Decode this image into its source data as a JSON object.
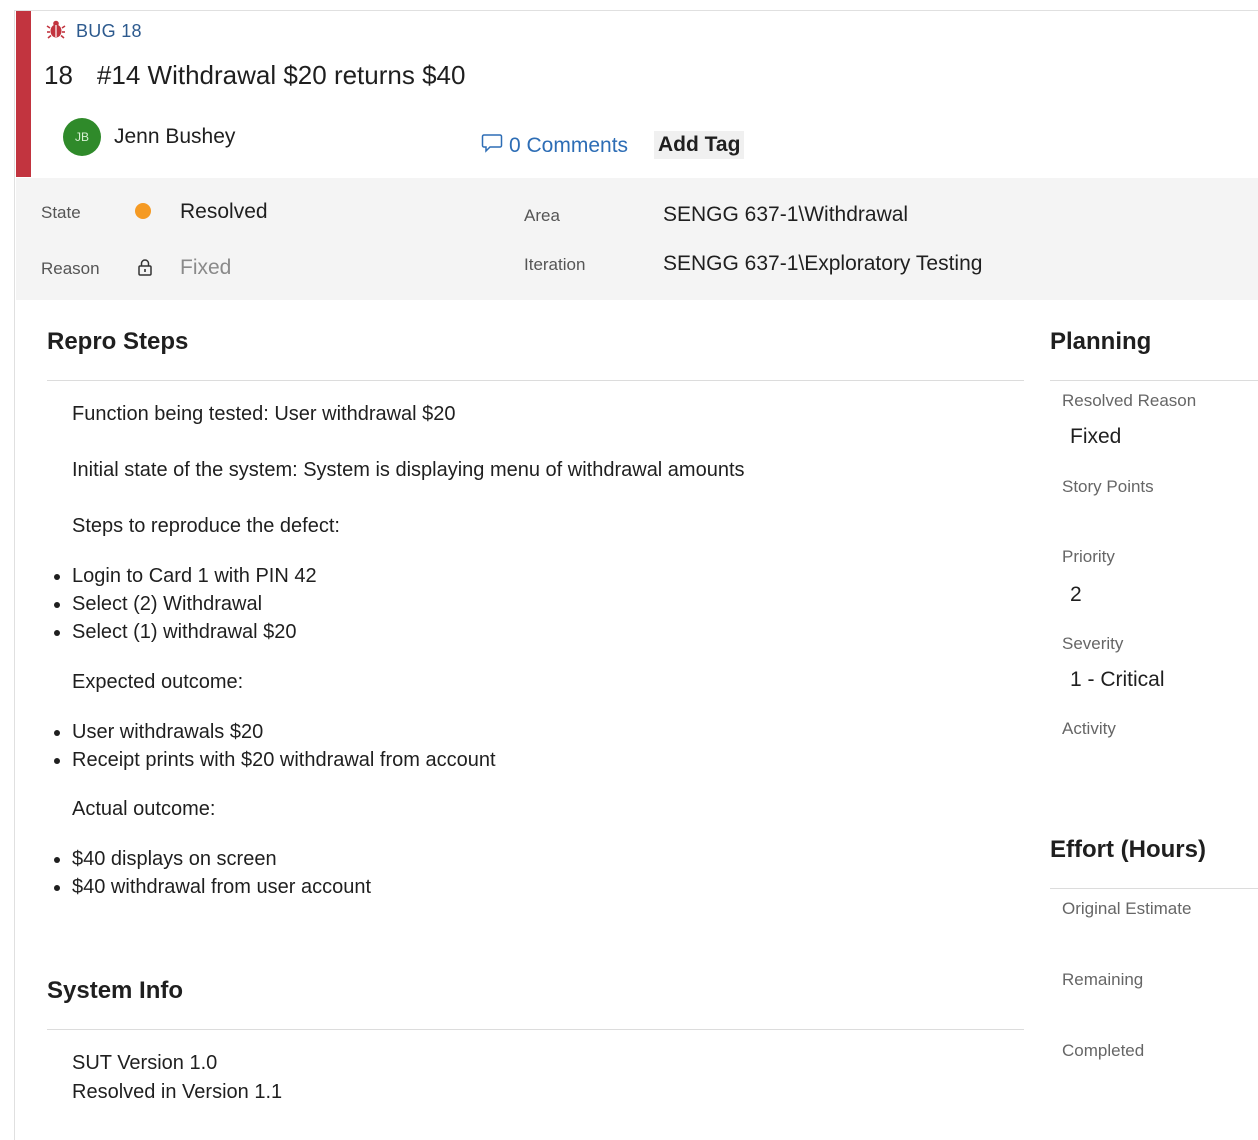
{
  "header": {
    "type_label": "BUG 18",
    "id": "18",
    "title": "#14 Withdrawal $20 returns $40",
    "assignee": {
      "initials": "JB",
      "name": "Jenn Bushey"
    },
    "comments_label": "0 Comments",
    "add_tag_label": "Add Tag",
    "colors": {
      "bar": "#c2343f",
      "avatar": "#2f8a2a",
      "link": "#2d6db5"
    }
  },
  "fields": {
    "state_label": "State",
    "state_value": "Resolved",
    "state_color": "#f59a23",
    "reason_label": "Reason",
    "reason_value": "Fixed",
    "area_label": "Area",
    "area_value": "SENGG 637-1\\Withdrawal",
    "iteration_label": "Iteration",
    "iteration_value": "SENGG 637-1\\Exploratory Testing"
  },
  "repro": {
    "heading": "Repro Steps",
    "function_line": "Function being tested: User withdrawal $20",
    "initial_state_line": "Initial state of the system: System is displaying menu of withdrawal amounts",
    "steps_heading": "Steps to reproduce the defect:",
    "steps": [
      "Login to Card 1 with PIN 42",
      "Select (2) Withdrawal",
      "Select (1) withdrawal $20"
    ],
    "expected_heading": "Expected outcome:",
    "expected": [
      "User withdrawals $20",
      "Receipt prints with $20 withdrawal from account"
    ],
    "actual_heading": "Actual outcome:",
    "actual": [
      "$40 displays on screen",
      "$40 withdrawal from user account"
    ]
  },
  "system_info": {
    "heading": "System Info",
    "lines": [
      "SUT Version 1.0",
      "Resolved in Version 1.1"
    ]
  },
  "planning": {
    "heading": "Planning",
    "resolved_reason_label": "Resolved Reason",
    "resolved_reason_value": "Fixed",
    "story_points_label": "Story Points",
    "priority_label": "Priority",
    "priority_value": "2",
    "severity_label": "Severity",
    "severity_value": "1 - Critical",
    "activity_label": "Activity"
  },
  "effort": {
    "heading": "Effort (Hours)",
    "original_label": "Original Estimate",
    "remaining_label": "Remaining",
    "completed_label": "Completed"
  },
  "icons": [
    "bug-icon",
    "comment-icon",
    "lock-icon"
  ]
}
